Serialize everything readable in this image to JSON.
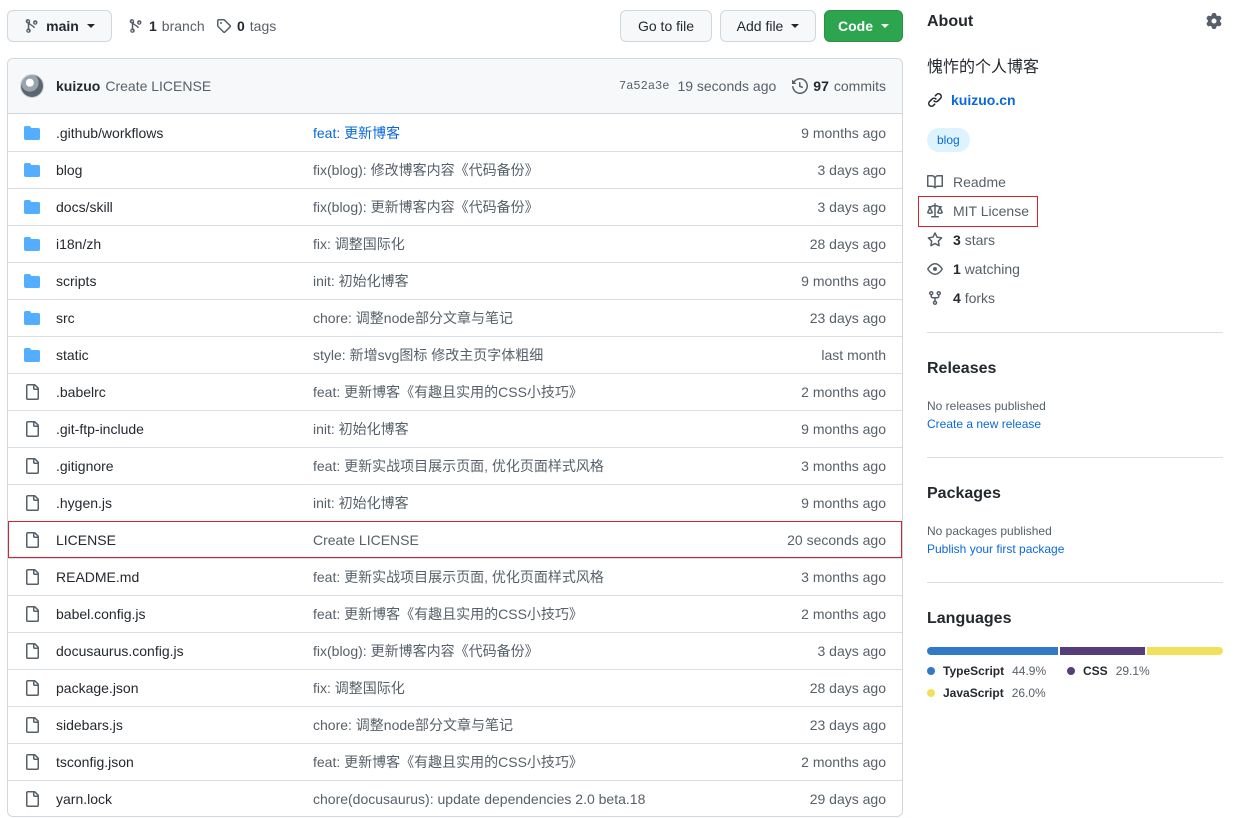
{
  "toolbar": {
    "branch_label": "main",
    "branches_count": "1",
    "branches_label": "branch",
    "tags_count": "0",
    "tags_label": "tags",
    "go_to_file": "Go to file",
    "add_file": "Add file",
    "code": "Code"
  },
  "commit": {
    "author": "kuizuo",
    "message": "Create LICENSE",
    "sha": "7a52a3e",
    "time": "19 seconds ago",
    "commits_count": "97",
    "commits_label": "commits"
  },
  "files": [
    {
      "type": "dir",
      "name": ".github/workflows",
      "message": "feat: 更新博客",
      "age": "9 months ago",
      "link": true
    },
    {
      "type": "dir",
      "name": "blog",
      "message": "fix(blog): 修改博客内容《代码备份》",
      "age": "3 days ago",
      "link": false
    },
    {
      "type": "dir",
      "name": "docs/skill",
      "message": "fix(blog): 更新博客内容《代码备份》",
      "age": "3 days ago",
      "link": false
    },
    {
      "type": "dir",
      "name": "i18n/zh",
      "message": "fix: 调整国际化",
      "age": "28 days ago",
      "link": false
    },
    {
      "type": "dir",
      "name": "scripts",
      "message": "init: 初始化博客",
      "age": "9 months ago",
      "link": false
    },
    {
      "type": "dir",
      "name": "src",
      "message": "chore: 调整node部分文章与笔记",
      "age": "23 days ago",
      "link": false
    },
    {
      "type": "dir",
      "name": "static",
      "message": "style: 新增svg图标 修改主页字体粗细",
      "age": "last month",
      "link": false
    },
    {
      "type": "file",
      "name": ".babelrc",
      "message": "feat: 更新博客《有趣且实用的CSS小技巧》",
      "age": "2 months ago",
      "link": false
    },
    {
      "type": "file",
      "name": ".git-ftp-include",
      "message": "init: 初始化博客",
      "age": "9 months ago",
      "link": false
    },
    {
      "type": "file",
      "name": ".gitignore",
      "message": "feat: 更新实战项目展示页面, 优化页面样式风格",
      "age": "3 months ago",
      "link": false
    },
    {
      "type": "file",
      "name": ".hygen.js",
      "message": "init: 初始化博客",
      "age": "9 months ago",
      "link": false
    },
    {
      "type": "file",
      "name": "LICENSE",
      "message": "Create LICENSE",
      "age": "20 seconds ago",
      "link": false,
      "highlight": true
    },
    {
      "type": "file",
      "name": "README.md",
      "message": "feat: 更新实战项目展示页面, 优化页面样式风格",
      "age": "3 months ago",
      "link": false
    },
    {
      "type": "file",
      "name": "babel.config.js",
      "message": "feat: 更新博客《有趣且实用的CSS小技巧》",
      "age": "2 months ago",
      "link": false
    },
    {
      "type": "file",
      "name": "docusaurus.config.js",
      "message": "fix(blog): 更新博客内容《代码备份》",
      "age": "3 days ago",
      "link": false
    },
    {
      "type": "file",
      "name": "package.json",
      "message": "fix: 调整国际化",
      "age": "28 days ago",
      "link": false
    },
    {
      "type": "file",
      "name": "sidebars.js",
      "message": "chore: 调整node部分文章与笔记",
      "age": "23 days ago",
      "link": false
    },
    {
      "type": "file",
      "name": "tsconfig.json",
      "message": "feat: 更新博客《有趣且实用的CSS小技巧》",
      "age": "2 months ago",
      "link": false
    },
    {
      "type": "file",
      "name": "yarn.lock",
      "message": "chore(docusaurus): update dependencies 2.0 beta.18",
      "age": "29 days ago",
      "link": false
    }
  ],
  "about": {
    "title": "About",
    "description": "愧怍的个人博客",
    "homepage": "kuizuo.cn",
    "topic": "blog",
    "readme": "Readme",
    "license": "MIT License",
    "stars_count": "3",
    "stars_label": "stars",
    "watching_count": "1",
    "watching_label": "watching",
    "forks_count": "4",
    "forks_label": "forks"
  },
  "releases": {
    "title": "Releases",
    "text": "No releases published",
    "link": "Create a new release"
  },
  "packages": {
    "title": "Packages",
    "text": "No packages published",
    "link": "Publish your first package"
  },
  "languages": {
    "title": "Languages",
    "items": [
      {
        "name": "TypeScript",
        "percent": "44.9%",
        "value": 44.9,
        "color": "#3178c6"
      },
      {
        "name": "CSS",
        "percent": "29.1%",
        "value": 29.1,
        "color": "#563d7c"
      },
      {
        "name": "JavaScript",
        "percent": "26.0%",
        "value": 26.0,
        "color": "#f1e05a"
      }
    ]
  },
  "colors": {
    "accent": "#0969da",
    "code_button": "#2da44e",
    "folder_icon": "#54aeff",
    "highlight_border": "#d1242f"
  }
}
